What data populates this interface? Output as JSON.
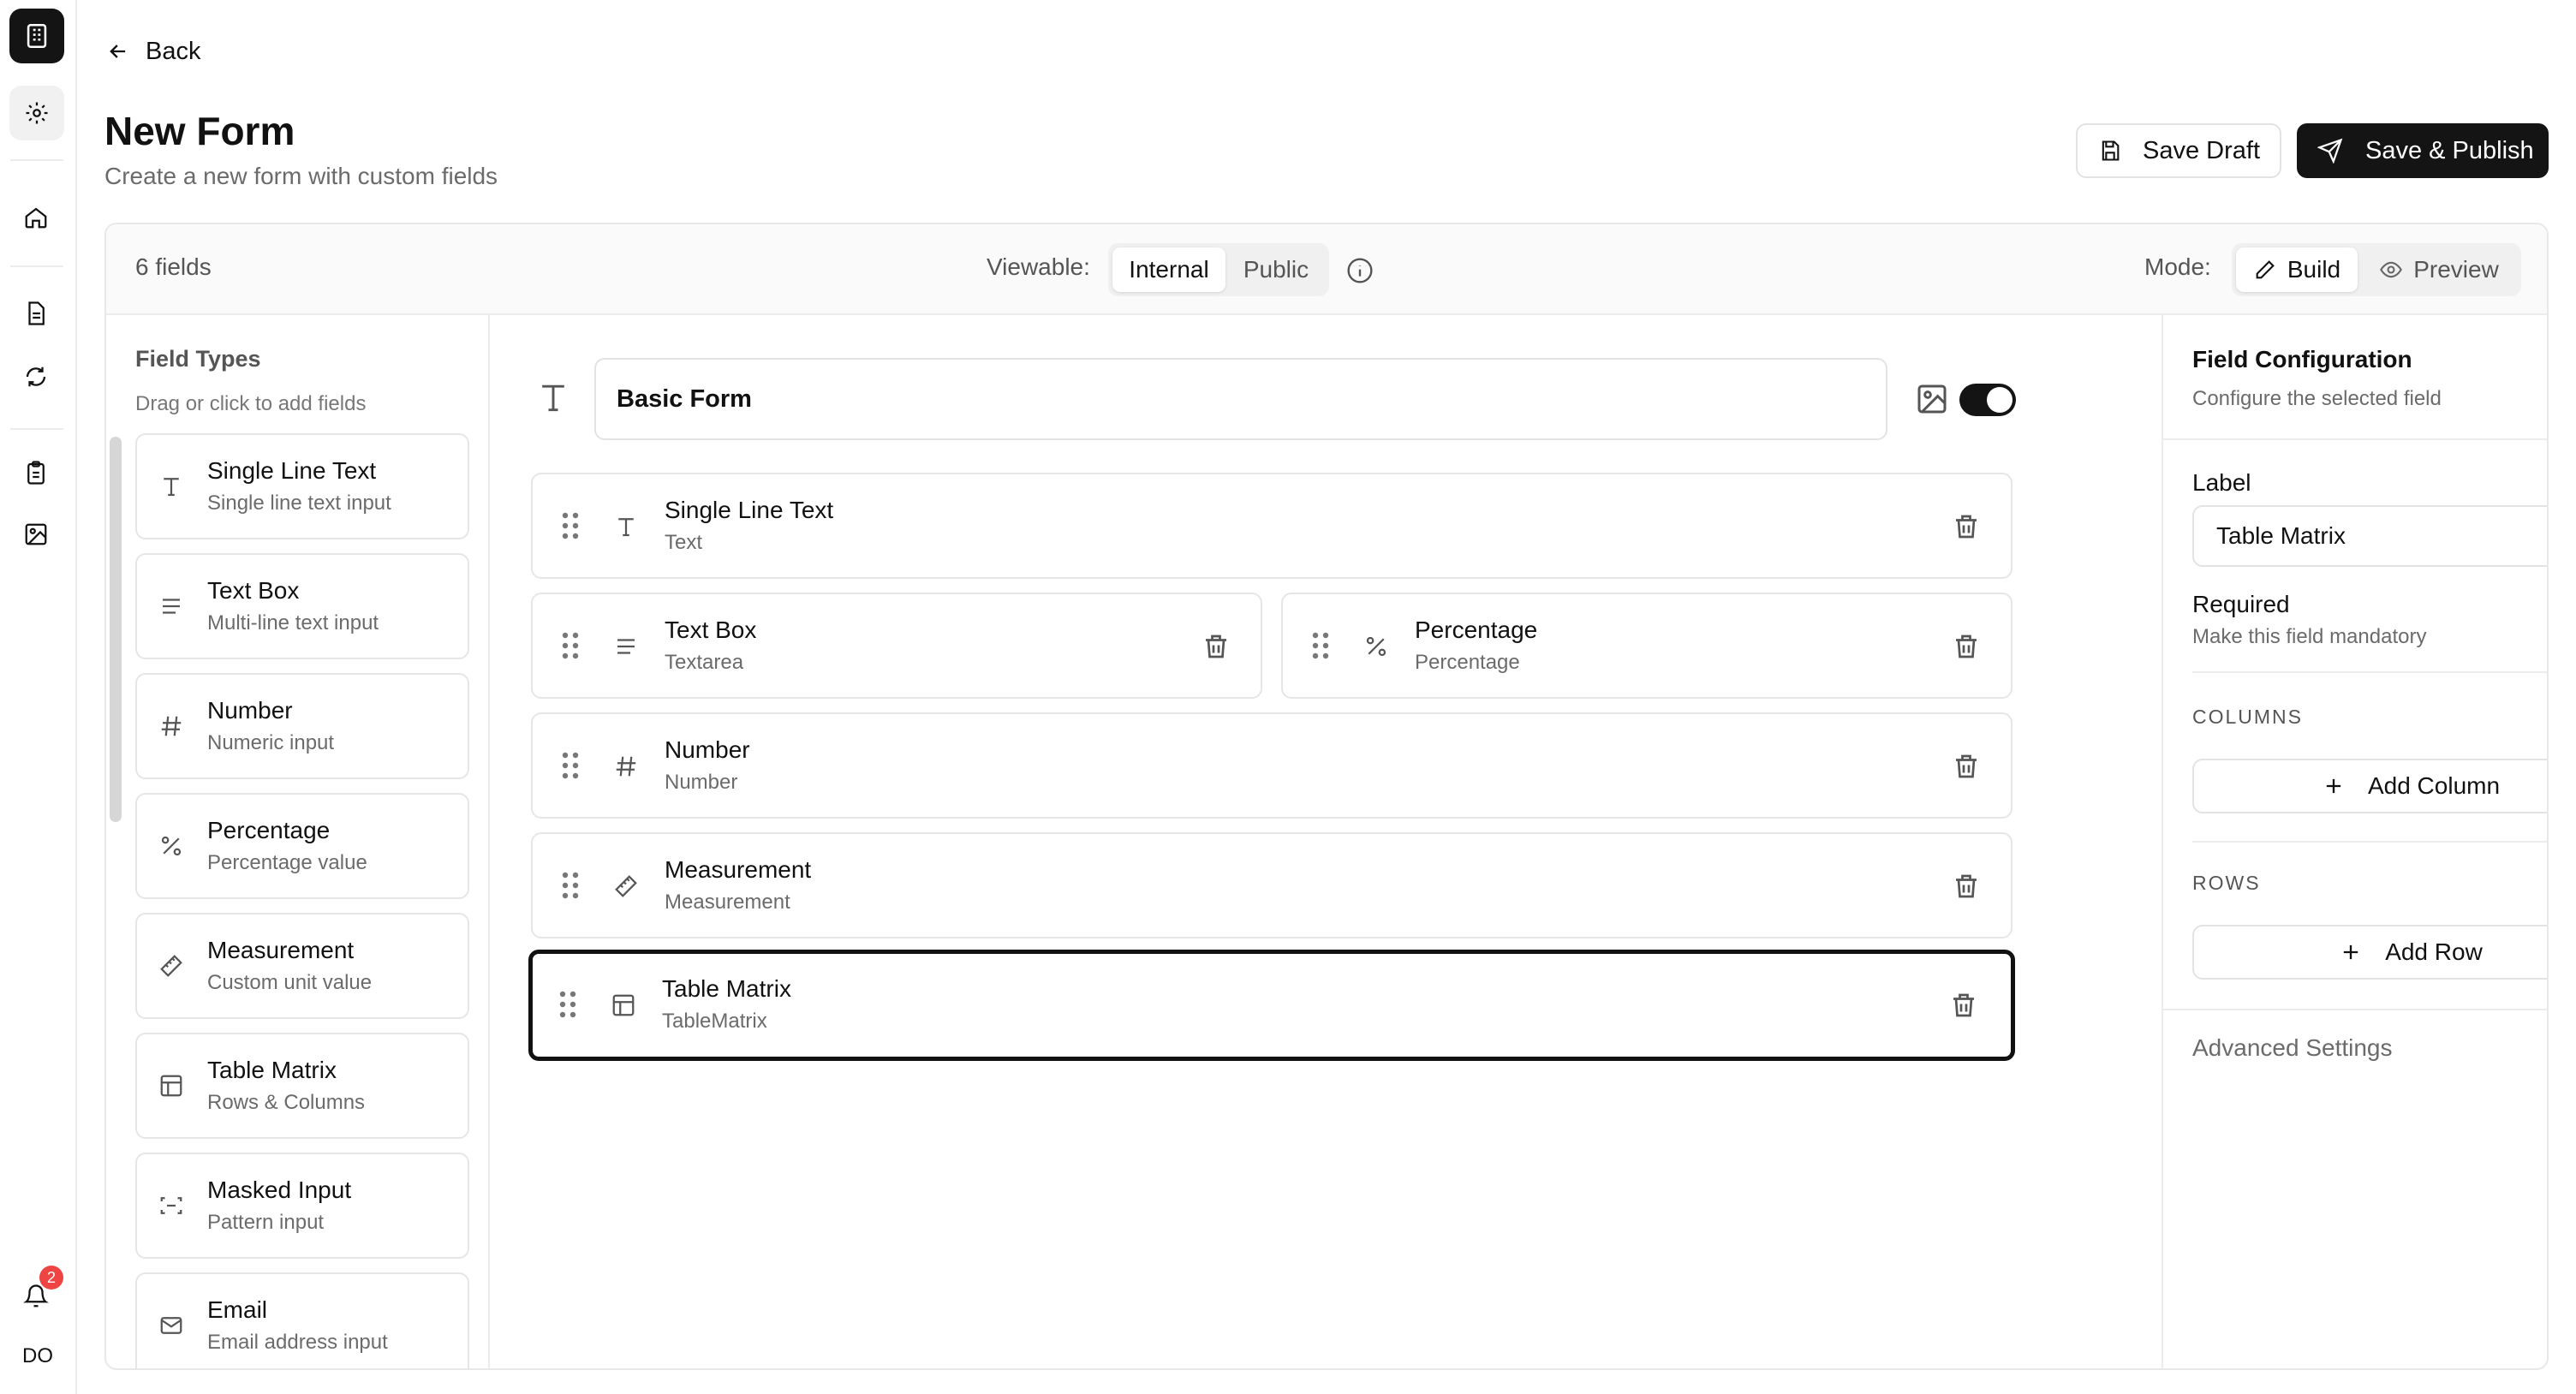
{
  "nav": {
    "back_label": "Back",
    "notification_count": "2",
    "avatar_initials": "DO"
  },
  "header": {
    "title": "New Form",
    "subtitle": "Create a new form with custom fields",
    "save_draft_label": "Save Draft",
    "save_publish_label": "Save & Publish"
  },
  "toolbar": {
    "fields_count": "6 fields",
    "viewable_label": "Viewable:",
    "viewable_options": [
      "Internal",
      "Public"
    ],
    "viewable_selected": "Internal",
    "mode_label": "Mode:",
    "mode_options": [
      "Build",
      "Preview"
    ],
    "mode_selected": "Build"
  },
  "field_types": {
    "title": "Field Types",
    "subtitle": "Drag or click to add fields",
    "items": [
      {
        "name": "Single Line Text",
        "desc": "Single line text input",
        "icon": "text-icon"
      },
      {
        "name": "Text Box",
        "desc": "Multi-line text input",
        "icon": "lines-icon"
      },
      {
        "name": "Number",
        "desc": "Numeric input",
        "icon": "hash-icon"
      },
      {
        "name": "Percentage",
        "desc": "Percentage value",
        "icon": "percent-icon"
      },
      {
        "name": "Measurement",
        "desc": "Custom unit value",
        "icon": "ruler-icon"
      },
      {
        "name": "Table Matrix",
        "desc": "Rows & Columns",
        "icon": "table-icon"
      },
      {
        "name": "Masked Input",
        "desc": "Pattern input",
        "icon": "scan-icon"
      },
      {
        "name": "Email",
        "desc": "Email address input",
        "icon": "mail-icon"
      }
    ]
  },
  "form": {
    "title": "Basic Form",
    "header_toggle_on": true,
    "fields": [
      {
        "name": "Single Line Text",
        "type": "Text",
        "icon": "text-icon"
      },
      {
        "name": "Text Box",
        "type": "Textarea",
        "icon": "lines-icon"
      },
      {
        "name": "Percentage",
        "type": "Percentage",
        "icon": "percent-icon"
      },
      {
        "name": "Number",
        "type": "Number",
        "icon": "hash-icon"
      },
      {
        "name": "Measurement",
        "type": "Measurement",
        "icon": "ruler-icon"
      },
      {
        "name": "Table Matrix",
        "type": "TableMatrix",
        "icon": "table-icon",
        "selected": true
      }
    ]
  },
  "config": {
    "title": "Field Configuration",
    "subtitle": "Configure the selected field",
    "label_heading": "Label",
    "label_value": "Table Matrix",
    "required_heading": "Required",
    "required_desc": "Make this field mandatory",
    "required_on": false,
    "columns_heading": "COLUMNS",
    "add_column_label": "Add Column",
    "rows_heading": "ROWS",
    "add_row_label": "Add Row",
    "advanced_label": "Advanced Settings"
  },
  "colors": {
    "primary": "#141414",
    "border": "#e6e6e6",
    "muted_text": "#6b6b6b",
    "badge": "#ef4444"
  }
}
